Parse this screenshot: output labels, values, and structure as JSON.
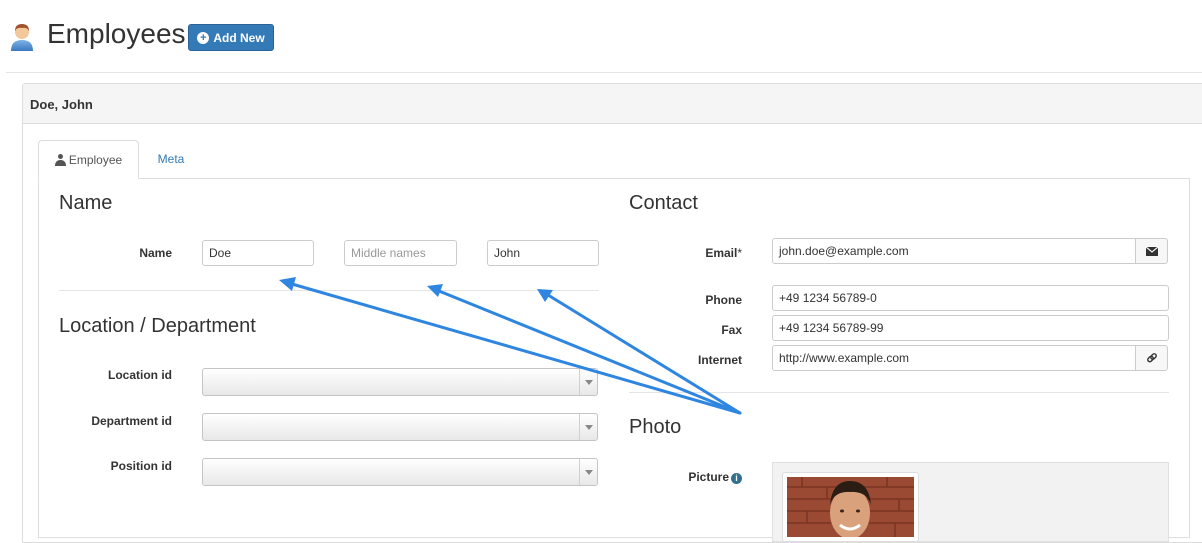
{
  "header": {
    "title": "Employees",
    "add_button_label": "Add New"
  },
  "panel": {
    "title": "Doe, John"
  },
  "tabs": [
    {
      "label": "Employee",
      "active": true
    },
    {
      "label": "Meta",
      "active": false
    }
  ],
  "sections": {
    "name": {
      "heading": "Name",
      "label": "Name",
      "last_name": "Doe",
      "middle_names_placeholder": "Middle names",
      "first_name": "John"
    },
    "location": {
      "heading": "Location / Department",
      "location_label": "Location id",
      "department_label": "Department id",
      "position_label": "Position id"
    },
    "contact": {
      "heading": "Contact",
      "email_label": "Email",
      "required_mark": "*",
      "email": "john.doe@example.com",
      "phone_label": "Phone",
      "phone": "+49 1234 56789-0",
      "fax_label": "Fax",
      "fax": "+49 1234 56789-99",
      "internet_label": "Internet",
      "internet": "http://www.example.com"
    },
    "photo": {
      "heading": "Photo",
      "picture_label": "Picture"
    }
  },
  "colors": {
    "primary": "#337ab7",
    "link": "#337ab7",
    "annotation_arrow": "#2f86e0"
  },
  "icons": [
    "user-avatar-icon",
    "plus-circle-icon",
    "person-icon",
    "envelope-icon",
    "link-icon",
    "info-icon",
    "caret-down-icon"
  ]
}
